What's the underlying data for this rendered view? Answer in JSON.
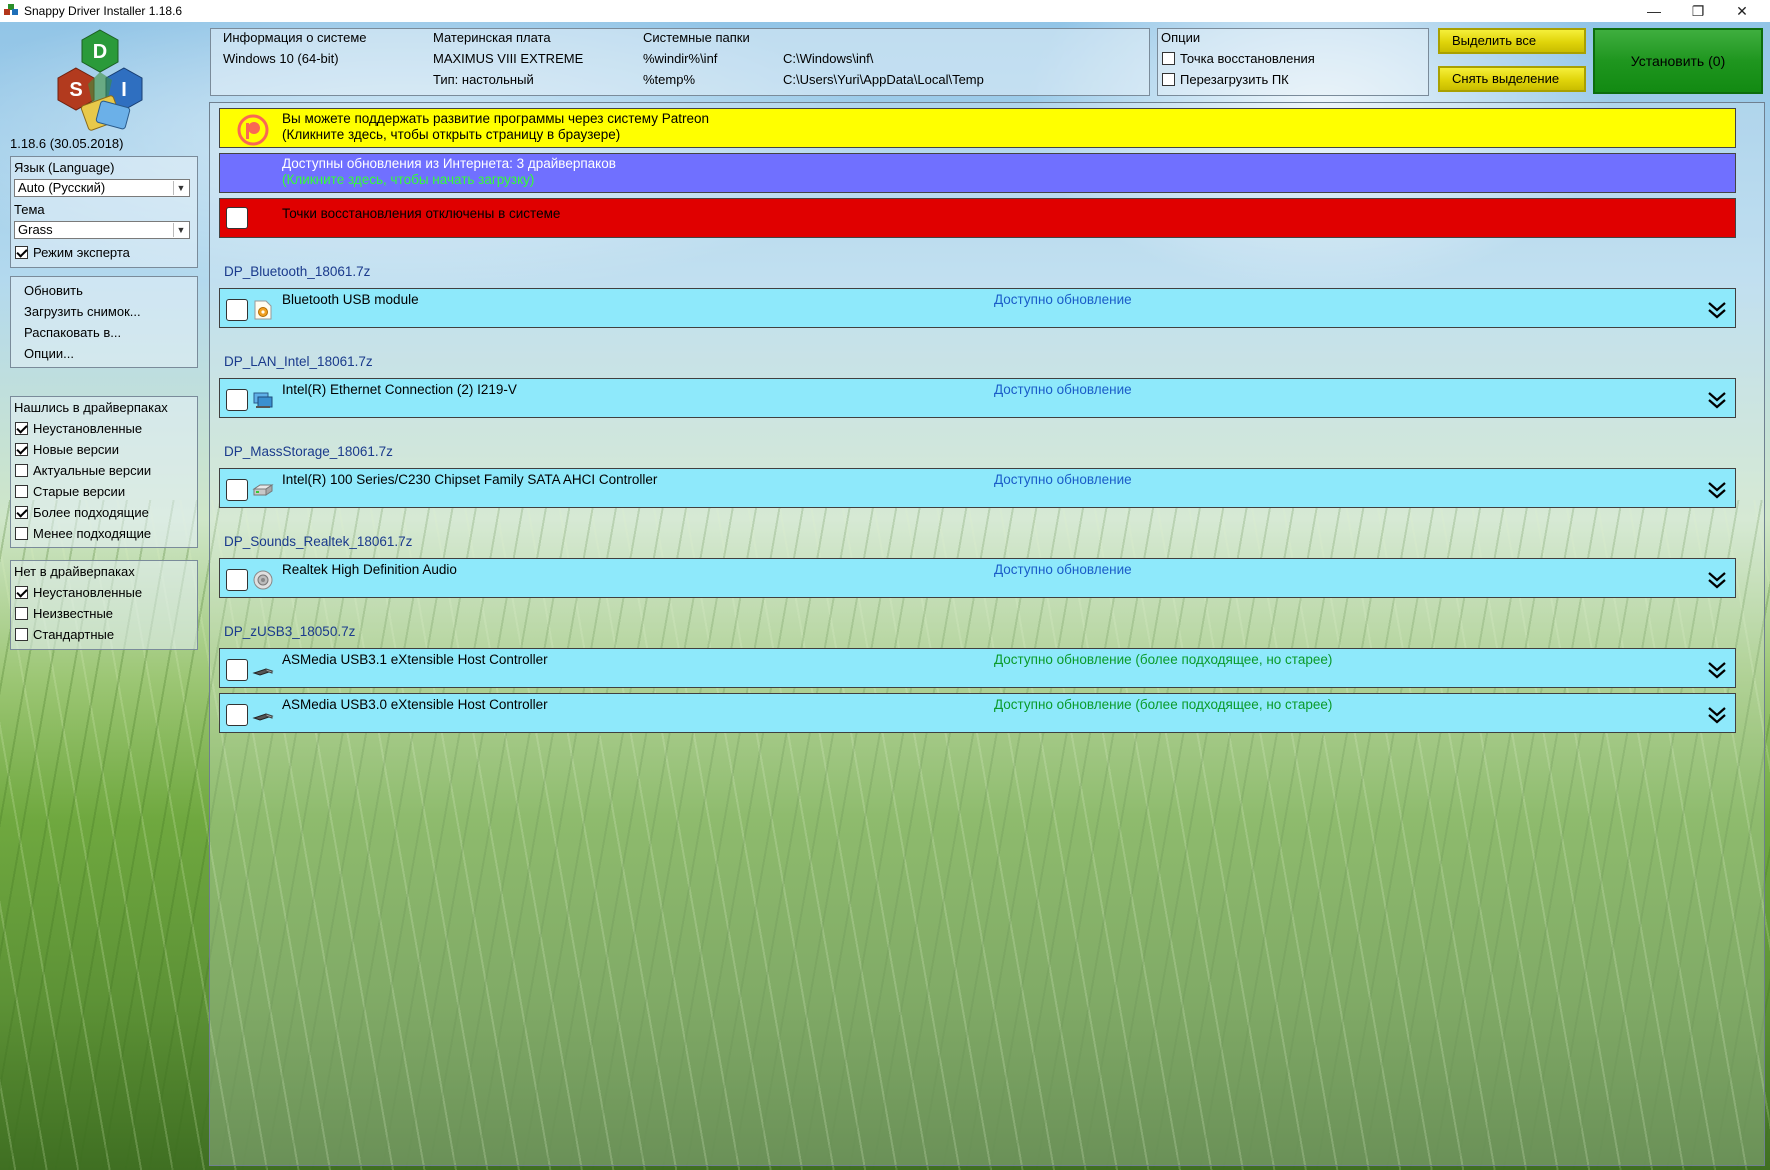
{
  "window": {
    "title": "Snappy Driver Installer 1.18.6",
    "controls": {
      "minimize": "—",
      "maximize": "❐",
      "close": "✕"
    }
  },
  "sidebar": {
    "logo_letters": {
      "top": "D",
      "left": "S",
      "right": "I"
    },
    "version": "1.18.6 (30.05.2018)",
    "language_label": "Язык (Language)",
    "language_value": "Auto (Русский)",
    "theme_label": "Тема",
    "theme_value": "Grass",
    "expert_mode": {
      "label": "Режим эксперта",
      "checked": true
    },
    "actions": [
      "Обновить",
      "Загрузить снимок...",
      "Распаковать в...",
      "Опции..."
    ],
    "found_group": {
      "title": "Нашлись в драйверпаках",
      "items": [
        {
          "label": "Неустановленные",
          "checked": true
        },
        {
          "label": "Новые версии",
          "checked": true
        },
        {
          "label": "Актуальные версии",
          "checked": false
        },
        {
          "label": "Старые версии",
          "checked": false
        },
        {
          "label": "Более подходящие",
          "checked": true
        },
        {
          "label": "Менее подходящие",
          "checked": false
        }
      ]
    },
    "notfound_group": {
      "title": "Нет в драйверпаках",
      "items": [
        {
          "label": "Неустановленные",
          "checked": true
        },
        {
          "label": "Неизвестные",
          "checked": false
        },
        {
          "label": "Стандартные",
          "checked": false
        }
      ]
    }
  },
  "sysinfo": {
    "system_title": "Информация о системе",
    "os": "Windows 10 (64-bit)",
    "board_title": "Материнская плата",
    "board": "MAXIMUS VIII EXTREME",
    "type": "Тип: настольный",
    "folders_title": "Системные папки",
    "folder1_var": "%windir%\\inf",
    "folder1_path": "C:\\Windows\\inf\\",
    "folder2_var": "%temp%",
    "folder2_path": "C:\\Users\\Yuri\\AppData\\Local\\Temp"
  },
  "options": {
    "title": "Опции",
    "restore_point": {
      "label": "Точка восстановления",
      "checked": false
    },
    "reboot": {
      "label": "Перезагрузить ПК",
      "checked": false
    }
  },
  "buttons": {
    "select_all": "Выделить все",
    "deselect": "Снять выделение",
    "install": "Установить (0)"
  },
  "banners": {
    "patreon": {
      "line1": "Вы можете поддержать развитие программы через систему Patreon",
      "line2": "(Кликните здесь, чтобы открыть страницу в браузере)",
      "color": "#ffff00"
    },
    "updates": {
      "line1": "Доступны обновления из Интернета: 3 драйверпаков",
      "line2": "(Кликните здесь, чтобы начать загрузку)",
      "color": "#7070ff",
      "line1_color": "#ffffff",
      "line2_color": "#33ff33"
    },
    "restore": {
      "line1": "Точки восстановления отключены в системе",
      "color": "#e00000"
    }
  },
  "driver_groups": [
    {
      "pack": "DP_Bluetooth_18061.7z",
      "drivers": [
        {
          "name": "Bluetooth USB module",
          "status": "Доступно обновление",
          "status_color": "#1a5cc8",
          "icon": "gear-icon"
        }
      ]
    },
    {
      "pack": "DP_LAN_Intel_18061.7z",
      "drivers": [
        {
          "name": "Intel(R) Ethernet Connection (2) I219-V",
          "status": "Доступно обновление",
          "status_color": "#1a5cc8",
          "icon": "network-icon"
        }
      ]
    },
    {
      "pack": "DP_MassStorage_18061.7z",
      "drivers": [
        {
          "name": "Intel(R) 100 Series/C230 Chipset Family SATA AHCI Controller",
          "status": "Доступно обновление",
          "status_color": "#1a5cc8",
          "icon": "disk-icon"
        }
      ]
    },
    {
      "pack": "DP_Sounds_Realtek_18061.7z",
      "drivers": [
        {
          "name": "Realtek High Definition Audio",
          "status": "Доступно обновление",
          "status_color": "#1a5cc8",
          "icon": "speaker-icon"
        }
      ]
    },
    {
      "pack": "DP_zUSB3_18050.7z",
      "drivers": [
        {
          "name": "ASMedia USB3.1 eXtensible Host Controller",
          "status": "Доступно обновление (более подходящее, но старее)",
          "status_color": "#0a9a2a",
          "icon": "usb-icon"
        },
        {
          "name": "ASMedia USB3.0 eXtensible Host Controller",
          "status": "Доступно обновление (более подходящее, но старее)",
          "status_color": "#0a9a2a",
          "icon": "usb-icon"
        }
      ]
    }
  ]
}
